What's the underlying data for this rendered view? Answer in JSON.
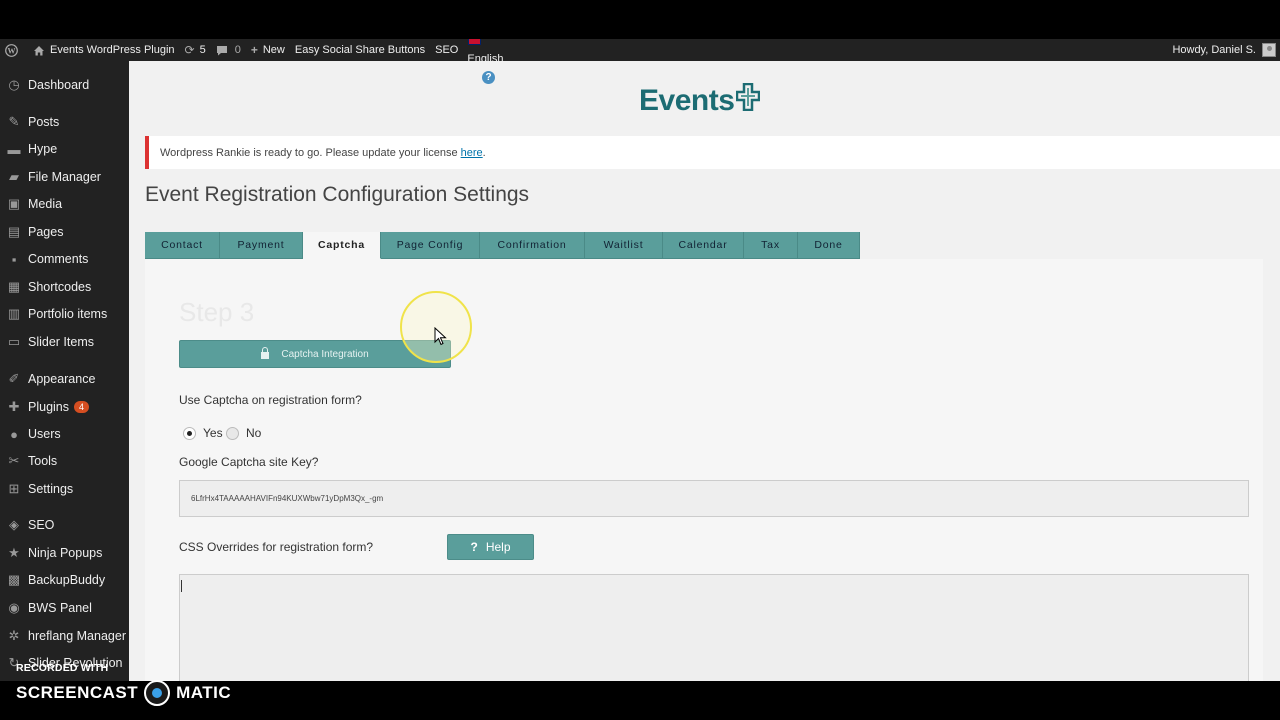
{
  "adminbar": {
    "site_name": "Events WordPress Plugin",
    "updates_count": "5",
    "comments_count": "0",
    "new_label": "New",
    "plugin_link": "Easy Social Share Buttons",
    "seo_label": "SEO",
    "language": "English",
    "howdy": "Howdy, Daniel S."
  },
  "sidebar": {
    "items": [
      {
        "label": "Dashboard",
        "icon": "dashboard-icon"
      },
      {
        "label": "Posts",
        "icon": "pin-icon"
      },
      {
        "label": "Hype",
        "icon": "hype-icon"
      },
      {
        "label": "File Manager",
        "icon": "folder-icon"
      },
      {
        "label": "Media",
        "icon": "media-icon"
      },
      {
        "label": "Pages",
        "icon": "pages-icon"
      },
      {
        "label": "Comments",
        "icon": "comment-icon"
      },
      {
        "label": "Shortcodes",
        "icon": "shortcode-icon"
      },
      {
        "label": "Portfolio items",
        "icon": "portfolio-icon"
      },
      {
        "label": "Slider Items",
        "icon": "slider-icon"
      },
      {
        "label": "Appearance",
        "icon": "brush-icon"
      },
      {
        "label": "Plugins",
        "icon": "plugin-icon",
        "badge": "4"
      },
      {
        "label": "Users",
        "icon": "users-icon"
      },
      {
        "label": "Tools",
        "icon": "wrench-icon"
      },
      {
        "label": "Settings",
        "icon": "settings-icon"
      },
      {
        "label": "SEO",
        "icon": "seo-icon"
      },
      {
        "label": "Ninja Popups",
        "icon": "star-icon"
      },
      {
        "label": "BackupBuddy",
        "icon": "backup-icon"
      },
      {
        "label": "BWS Panel",
        "icon": "bws-icon"
      },
      {
        "label": "hreflang Manager",
        "icon": "gear-icon"
      },
      {
        "label": "Slider Revolution",
        "icon": "refresh-icon"
      }
    ]
  },
  "logo": {
    "text": "Events"
  },
  "notice": {
    "text": "Wordpress Rankie is ready to go. Please update your license",
    "link_text": "here",
    "suffix": "."
  },
  "page": {
    "title": "Event Registration Configuration Settings",
    "tabs": [
      "Contact",
      "Payment",
      "Captcha",
      "Page Config",
      "Confirmation",
      "Waitlist",
      "Calendar",
      "Tax",
      "Done"
    ],
    "active_tab": "Captcha",
    "step": "Step 3",
    "section_bar": "Captcha Integration",
    "use_captcha_label": "Use Captcha on registration form?",
    "yes_label": "Yes",
    "no_label": "No",
    "site_key_label": "Google Captcha site Key?",
    "site_key_value": "6LfrHx4TAAAAAHAVIFn94KUXWbw71yDpM3Qx_-gm",
    "css_label": "CSS Overrides for registration form?",
    "help_label": "Help",
    "css_value": ""
  },
  "watermark": {
    "top": "RECORDED WITH",
    "left": "SCREENCAST",
    "right": "MATIC"
  },
  "colors": {
    "teal": "#5a9e9b",
    "admin_bg": "#222222",
    "notice_border": "#dc3232",
    "logo": "#1c6c73"
  }
}
